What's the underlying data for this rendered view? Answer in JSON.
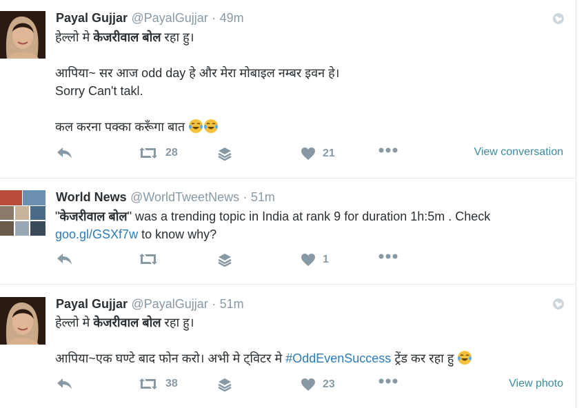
{
  "tweets": [
    {
      "name": "Payal Gujjar",
      "handle": "@PayalGujjar",
      "time": "49m",
      "lines": {
        "l1a": "हेल्लो मे ",
        "l1b": "केजरीवाल बोल",
        "l1c": " रहा हु।",
        "l2": "आपिया~ सर आज odd day हे और मेरा मोबाइल नम्बर इवन हे।",
        "l3": "Sorry Can't takl.",
        "l4": "कल करना पक्का करूँगा बात "
      },
      "retweets": "28",
      "likes": "21",
      "view_label": "View conversation"
    },
    {
      "name": "World News",
      "handle": "@WorldTweetNews",
      "time": "51m",
      "lines": {
        "q1": "\"",
        "bold": "केजरीवाल बोल",
        "q2": "\" was a trending topic in India at rank 9 for duration 1h:5m . Check",
        "link": "goo.gl/GSXf7w",
        "tail": " to know why?"
      },
      "retweets": "",
      "likes": "1"
    },
    {
      "name": "Payal Gujjar",
      "handle": "@PayalGujjar",
      "time": "51m",
      "lines": {
        "l1a": "हेल्लो मे ",
        "l1b": "केजरीवाल बोल",
        "l1c": " रहा हु।",
        "l2a": "आपिया~एक घण्टे बाद फोन करो। अभी मे ट्विटर मे ",
        "hashtag": "#OddEvenSuccess",
        "l2b": " ट्रेंड कर रहा हु "
      },
      "retweets": "38",
      "likes": "23",
      "view_label": "View photo"
    }
  ],
  "dot": "·",
  "colors": {
    "accent": "#2b7bb9",
    "muted": "#8899a6",
    "view": "#3a8c9b"
  },
  "icons": [
    "reply-icon",
    "retweet-icon",
    "stack-icon",
    "heart-icon",
    "more-icon",
    "globe-icon",
    "laugh-cry-emoji"
  ]
}
